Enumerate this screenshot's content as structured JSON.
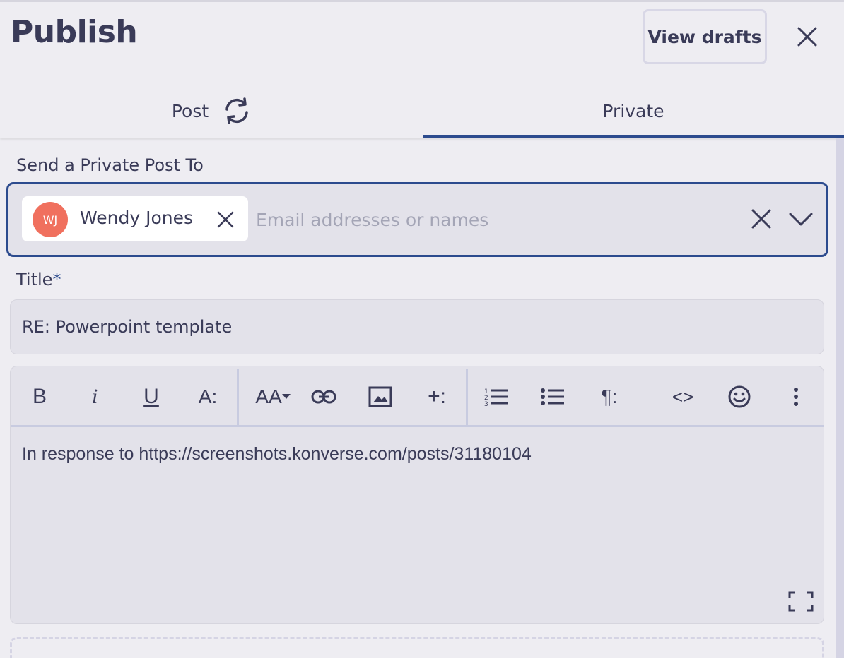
{
  "header": {
    "title": "Publish",
    "view_drafts_label": "View drafts",
    "close_icon": "close-icon"
  },
  "tabs": [
    {
      "label": "Post",
      "icon": "refresh-icon",
      "active": false
    },
    {
      "label": "Private",
      "active": true
    }
  ],
  "recipients": {
    "label": "Send a Private Post To",
    "chips": [
      {
        "initials": "WJ",
        "name": "Wendy Jones",
        "avatar_color": "#f0705e"
      }
    ],
    "input_value": "",
    "placeholder": "Email addresses or names"
  },
  "title_field": {
    "label": "Title",
    "required_mark": "*",
    "value": "RE: Powerpoint template"
  },
  "editor": {
    "toolbar": [
      {
        "name": "bold",
        "glyph": "B"
      },
      {
        "name": "italic",
        "glyph": "i"
      },
      {
        "name": "underline",
        "glyph": "U"
      },
      {
        "name": "text-style",
        "glyph": "A:"
      },
      {
        "name": "font-size",
        "glyph": "AA"
      },
      {
        "name": "link",
        "icon": "link-icon"
      },
      {
        "name": "image",
        "icon": "image-icon"
      },
      {
        "name": "insert-more",
        "glyph": "+:"
      },
      {
        "name": "ordered-list",
        "icon": "ordered-list-icon"
      },
      {
        "name": "bullet-list",
        "icon": "bullet-list-icon"
      },
      {
        "name": "paragraph",
        "glyph": "¶:"
      },
      {
        "name": "code",
        "glyph": "<>"
      },
      {
        "name": "emoji",
        "icon": "emoji-icon"
      },
      {
        "name": "more",
        "icon": "more-vertical-icon"
      }
    ],
    "body": "In response to https://screenshots.konverse.com/posts/31180104"
  },
  "colors": {
    "accent": "#2c4b8e",
    "background": "#eeedf2",
    "text": "#3a3b58",
    "avatar": "#f0705e"
  }
}
